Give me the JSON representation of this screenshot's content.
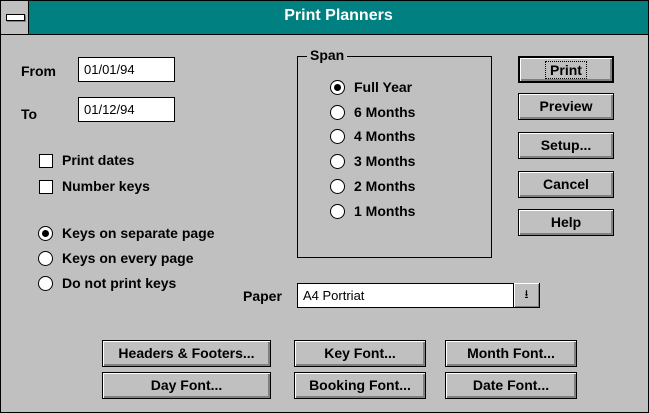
{
  "window": {
    "title": "Print Planners"
  },
  "from": {
    "label": "From",
    "value": "01/01/94"
  },
  "to": {
    "label": "To",
    "value": "01/12/94"
  },
  "options": {
    "print_dates": {
      "label": "Print dates",
      "checked": false
    },
    "number_keys": {
      "label": "Number keys",
      "checked": false
    }
  },
  "keys_placement": {
    "selected": "Keys on separate page",
    "options": [
      "Keys on separate page",
      "Keys on every page",
      "Do not print keys"
    ]
  },
  "span": {
    "label": "Span",
    "selected": "Full Year",
    "options": [
      "Full Year",
      "6 Months",
      "4 Months",
      "3 Months",
      "2 Months",
      "1 Months"
    ]
  },
  "paper": {
    "label": "Paper",
    "value": "A4 Portriat",
    "dropdown_glyph": "⭳"
  },
  "buttons": {
    "print": "Print",
    "preview": "Preview",
    "setup": "Setup...",
    "cancel": "Cancel",
    "help": "Help"
  },
  "font_buttons": {
    "headers_footers": "Headers & Footers...",
    "key_font": "Key Font...",
    "month_font": "Month Font...",
    "day_font": "Day Font...",
    "booking_font": "Booking Font...",
    "date_font": "Date Font..."
  },
  "colors": {
    "titlebar": "#008080",
    "face": "#c0c0c0",
    "field": "#ffffff"
  }
}
